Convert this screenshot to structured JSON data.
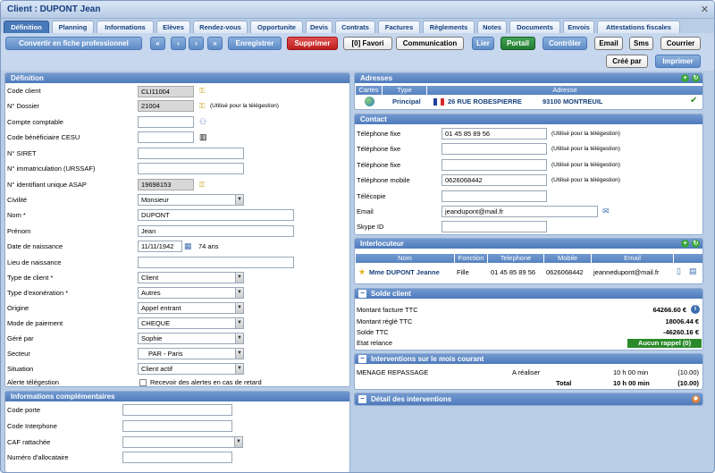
{
  "window": {
    "title": "Client : DUPONT Jean",
    "close": "✕"
  },
  "tabs": [
    "Définition",
    "Planning",
    "Informations",
    "Elèves",
    "Rendez-vous",
    "Opportunite",
    "Devis",
    "Contrats",
    "Factures",
    "Règlements",
    "Notes",
    "Documents",
    "Envois",
    "Attestations fiscales"
  ],
  "toolbar": {
    "convert": "Convertir en fiche professionnel",
    "first": "«",
    "prev": "‹",
    "next": "›",
    "last": "»",
    "save": "Enregistrer",
    "delete": "Supprimer",
    "favori": "[0] Favori",
    "communication": "Communication",
    "lier": "Lier",
    "portail": "Portail",
    "controler": "Contrôler",
    "email": "Email",
    "sms": "Sms",
    "courrier": "Courrier",
    "cree_par": "Créé par",
    "imprimer": "Imprimer"
  },
  "definition": {
    "title": "Définition",
    "code_client_label": "Code client",
    "code_client": "CLI11004",
    "dossier_label": "N° Dossier",
    "dossier": "21004",
    "dossier_note": "(Utilisé pour la télégestion)",
    "compte_label": "Compte comptable",
    "compte": "",
    "cesu_label": "Code bénéficiaire CESU",
    "cesu": "",
    "siret_label": "N° SIRET",
    "siret": "",
    "urssaf_label": "N° immatriculation (URSSAF)",
    "urssaf": "",
    "asap_label": "N° identifiant unique ASAP",
    "asap": "19698153",
    "civilite_label": "Civilité",
    "civilite": "Monsieur",
    "nom_label": "Nom *",
    "nom": "DUPONT",
    "prenom_label": "Prénom",
    "prenom": "Jean",
    "naissance_label": "Date de naissance",
    "naissance": "11/11/1942",
    "age": "74 ans",
    "lieu_label": "Lieu de naissance",
    "lieu": "",
    "type_label": "Type de client *",
    "type": "Client",
    "exo_label": "Type d'exonération *",
    "exo": "Autres",
    "origine_label": "Origine",
    "origine": "Appel entrant",
    "paiement_label": "Mode de paiement",
    "paiement": "CHEQUE",
    "gere_label": "Géré par",
    "gere": "Sophie",
    "secteur_label": "Secteur",
    "secteur": "PAR - Paris",
    "situation_label": "Situation",
    "situation": "Client actif",
    "alerte_label": "Alerte télégestion",
    "alerte_text": "Recevoir des alertes en cas de retard"
  },
  "infos": {
    "title": "Informations complémentaires",
    "porte_label": "Code porte",
    "porte": "",
    "interphone_label": "Code Interphone",
    "interphone": "",
    "caf_label": "CAF rattachée",
    "caf": "",
    "allocataire_label": "Numéro d'allocataire",
    "allocataire": ""
  },
  "adresses": {
    "title": "Adresses",
    "h_cartes": "Cartes",
    "h_type": "Type",
    "h_adresse": "Adresse",
    "type": "Principal",
    "adresse": "26 RUE ROBESPIERRE",
    "cp_ville": "93100 MONTREUIL"
  },
  "contact": {
    "title": "Contact",
    "tel_fixe_label": "Téléphone fixe",
    "tel_fixe": "01 45 85 89 56",
    "tel_fixe2_label": "Téléphone fixe",
    "tel_fixe2": "",
    "tel_fixe3_label": "Téléphone fixe",
    "tel_fixe3": "",
    "mobile_label": "Téléphone mobile",
    "mobile": "0626068442",
    "fax_label": "Télécopie",
    "fax": "",
    "email_label": "Email",
    "email": "jeandupont@mail.fr",
    "skype_label": "Skype ID",
    "skype": "",
    "note": "(Utilisé pour la télégestion)"
  },
  "interlocuteur": {
    "title": "Interlocuteur",
    "h_nom": "Nom",
    "h_fonction": "Fonction",
    "h_tel": "Telephone",
    "h_mobile": "Mobile",
    "h_email": "Email",
    "nom": "Mme DUPONT Jeanne",
    "fonction": "Fille",
    "tel": "01 45 85 89 56",
    "mobile": "0626068442",
    "email": "jeannedupont@mail.fr"
  },
  "solde": {
    "title": "Solde client",
    "facture_label": "Montant facture TTC",
    "facture": "64266.60 €",
    "regle_label": "Montant réglé TTC",
    "regle": "18006.44 €",
    "solde_label": "Solde TTC",
    "solde": "-46260.16 €",
    "relance_label": "Etat relance",
    "relance": "Aucun rappel (0)"
  },
  "interventions": {
    "title": "Interventions sur le mois courant",
    "type": "MENAGE REPASSAGE",
    "statut": "A réaliser",
    "duree": "10 h 00 min",
    "montant": "(10.00)",
    "total_label": "Total",
    "total_duree": "10 h 00 min",
    "total_montant": "(10.00)"
  },
  "detail": {
    "title": "Détail des interventions"
  },
  "colors": {
    "header": "#4e7bbb",
    "bg": "#c6d7ee",
    "red_button": "#bf1e1e",
    "green_button": "#217a2f"
  }
}
